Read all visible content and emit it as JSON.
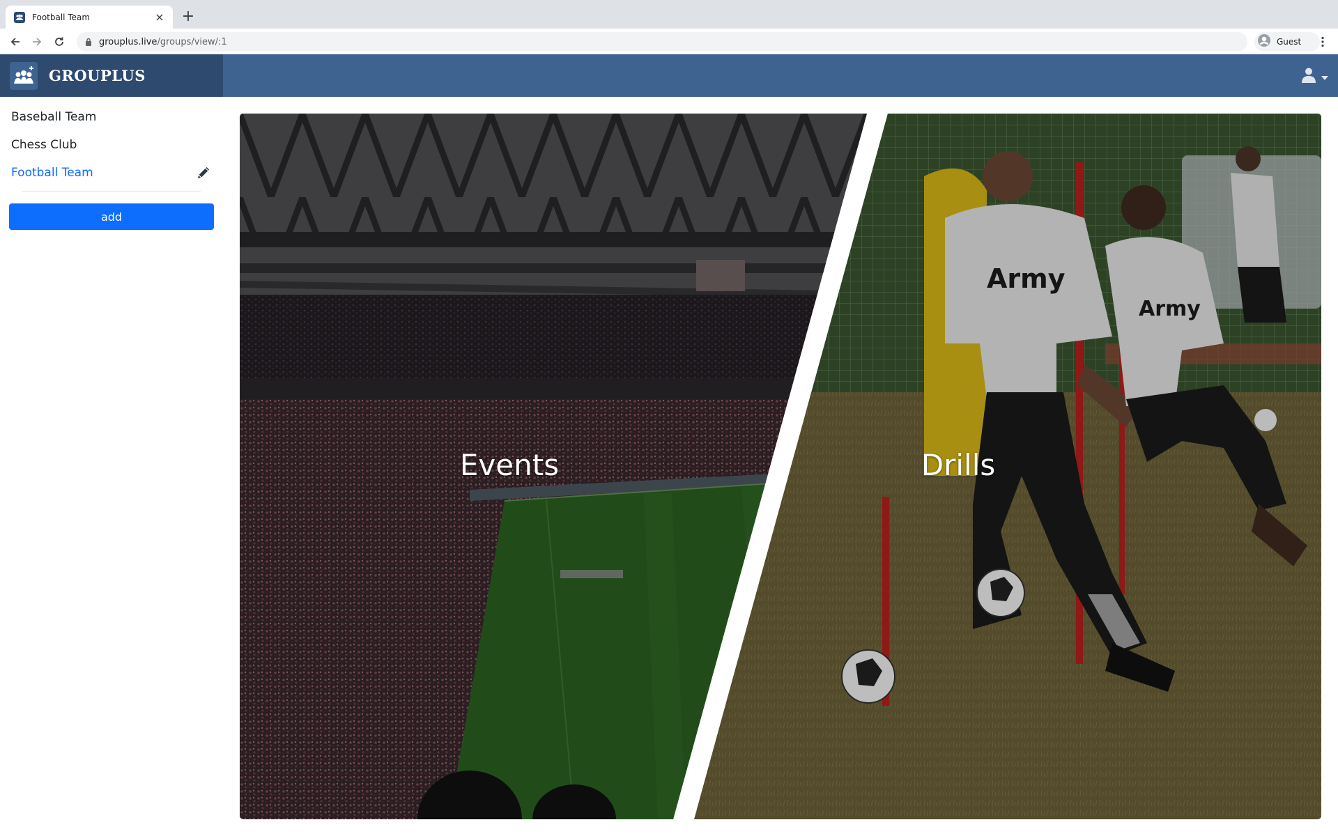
{
  "browser": {
    "tab_title": "Football Team",
    "tab_close": "×",
    "new_tab": "+",
    "url_host": "grouplus.live",
    "url_path": "/groups/view/:1",
    "profile_label": "Guest"
  },
  "app": {
    "brand_name": "GROUPLUS"
  },
  "sidebar": {
    "groups": [
      {
        "label": "Baseball Team",
        "active": false
      },
      {
        "label": "Chess Club",
        "active": false
      },
      {
        "label": "Football Team",
        "active": true
      }
    ],
    "add_label": "add"
  },
  "panels": {
    "events_label": "Events",
    "drills_label": "Drills"
  },
  "colors": {
    "header": "#3f6390",
    "brand_bg": "#2e4a6f",
    "accent": "#0d6efd"
  },
  "icons": {
    "edit": "pencil-icon",
    "user": "user-icon",
    "lock": "lock-icon"
  }
}
